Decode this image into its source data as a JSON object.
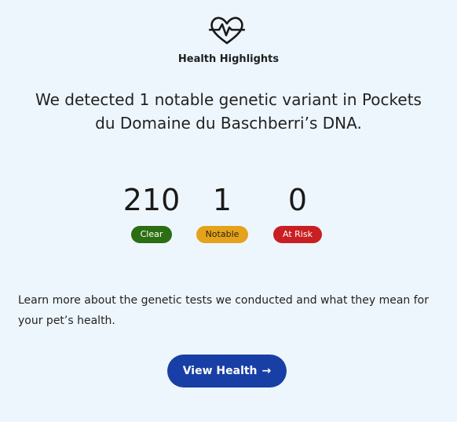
{
  "header": {
    "icon": "heart-pulse-icon",
    "title": "Health Highlights"
  },
  "headline": "We detected 1 notable genetic variant in Pockets du Domaine du Baschberri’s DNA.",
  "stats": [
    {
      "count": "210",
      "label": "Clear",
      "color": "#2c6e14"
    },
    {
      "count": "1",
      "label": "Notable",
      "color": "#e4a31a"
    },
    {
      "count": "0",
      "label": "At Risk",
      "color": "#c81f22"
    }
  ],
  "description": "Learn more about the genetic tests we conducted and what they mean for your pet’s health.",
  "cta": {
    "label": "View Health",
    "icon": "arrow-right-icon",
    "arrow": "→",
    "color": "#183fa6"
  },
  "colors": {
    "background": "#eef6fd",
    "text": "#222222"
  }
}
